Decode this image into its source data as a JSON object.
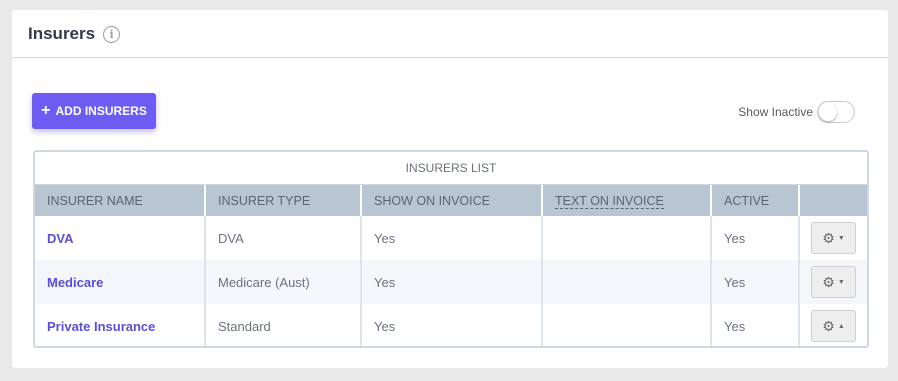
{
  "header": {
    "title": "Insurers",
    "info_icon": "info-icon"
  },
  "toolbar": {
    "add_label": "ADD INSURERS",
    "add_icon": "plus-icon",
    "show_inactive_label": "Show Inactive",
    "show_inactive_on": false
  },
  "table": {
    "caption": "INSURERS LIST",
    "columns": [
      "INSURER NAME",
      "INSURER TYPE",
      "SHOW ON INVOICE",
      "TEXT ON INVOICE",
      "ACTIVE",
      ""
    ],
    "rows": [
      {
        "name": "DVA",
        "type": "DVA",
        "show_on_invoice": "Yes",
        "text_on_invoice": "",
        "active": "Yes",
        "caret": "▼"
      },
      {
        "name": "Medicare",
        "type": "Medicare (Aust)",
        "show_on_invoice": "Yes",
        "text_on_invoice": "",
        "active": "Yes",
        "caret": "▼"
      },
      {
        "name": "Private Insurance",
        "type": "Standard",
        "show_on_invoice": "Yes",
        "text_on_invoice": "",
        "active": "Yes",
        "caret": "▲"
      }
    ]
  },
  "colors": {
    "accent": "#6c5cf2",
    "link": "#5b4fd6",
    "header_bg": "#b8c6d4"
  }
}
